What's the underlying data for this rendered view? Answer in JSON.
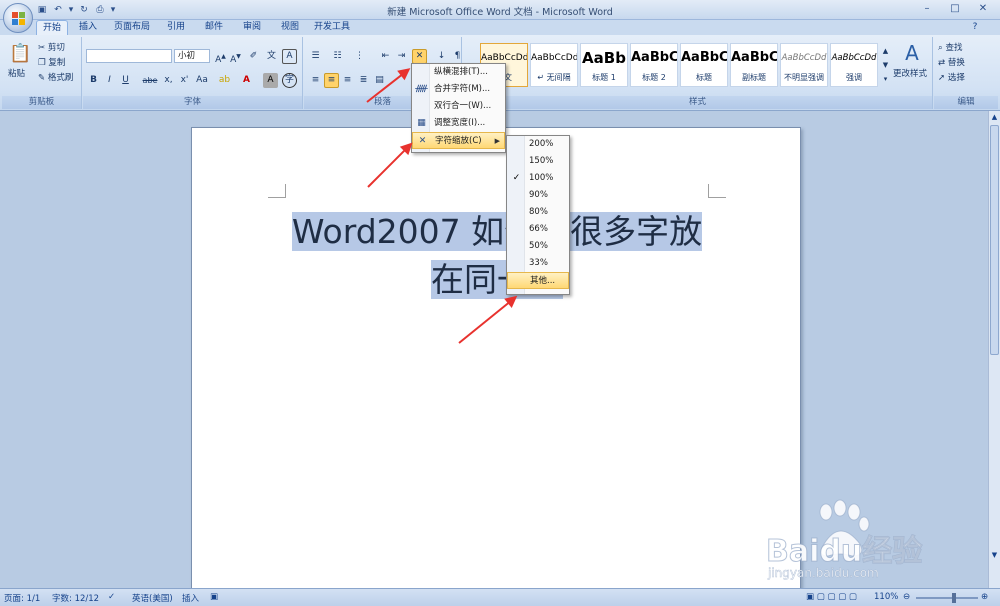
{
  "window": {
    "title": "新建 Microsoft Office Word 文档 - Microsoft Word"
  },
  "qat": [
    "save-icon",
    "undo-icon",
    "redo-icon",
    "print-preview-icon"
  ],
  "tabs": [
    "开始",
    "插入",
    "页面布局",
    "引用",
    "邮件",
    "审阅",
    "视图",
    "开发工具"
  ],
  "ribbon": {
    "clipboard": {
      "paste": "粘贴",
      "cut": "剪切",
      "copy": "复制",
      "format_painter": "格式刷",
      "label": "剪贴板"
    },
    "font": {
      "font_name": "",
      "font_size": "小初",
      "label": "字体",
      "bold": "B",
      "italic": "I",
      "underline": "U",
      "strike": "abe",
      "sub": "x,",
      "sup": "x'",
      "case": "Aa"
    },
    "paragraph": {
      "label": "段落"
    },
    "styles": {
      "label": "样式",
      "items": [
        {
          "preview": "AaBbCcDd",
          "name": "正文"
        },
        {
          "preview": "AaBbCcDd",
          "name": "↵ 无间隔"
        },
        {
          "preview": "AaBb",
          "name": "标题 1"
        },
        {
          "preview": "AaBbC",
          "name": "标题 2"
        },
        {
          "preview": "AaBbC",
          "name": "标题"
        },
        {
          "preview": "AaBbC",
          "name": "副标题"
        },
        {
          "preview": "AaBbCcDd",
          "name": "不明显强调"
        },
        {
          "preview": "AaBbCcDd",
          "name": "强调"
        }
      ],
      "change_styles": "更改样式"
    },
    "editing": {
      "find": "查找",
      "replace": "替换",
      "select": "选择",
      "label": "编辑"
    }
  },
  "document": {
    "line1": "Word2007 如何把很多字放",
    "line2": "在同一行"
  },
  "menu": {
    "items": [
      {
        "label": "纵横混排(T)..."
      },
      {
        "label": "合并字符(M)..."
      },
      {
        "label": "双行合一(W)..."
      },
      {
        "label": "调整宽度(I)..."
      },
      {
        "label": "字符缩放(C)"
      }
    ]
  },
  "submenu": {
    "items": [
      "200%",
      "150%",
      "100%",
      "90%",
      "80%",
      "66%",
      "50%",
      "33%",
      "其他..."
    ],
    "checked": "100%"
  },
  "status": {
    "page": "页面: 1/1",
    "words": "字数: 12/12",
    "lang": "英语(美国)",
    "mode": "插入",
    "zoom": "110%"
  },
  "watermark": {
    "brand": "Baidu经验",
    "url": "jingyan.baidu.com"
  }
}
